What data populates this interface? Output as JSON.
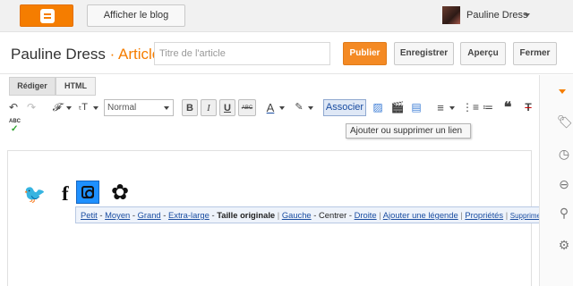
{
  "topbar": {
    "view_blog_label": "Afficher le blog",
    "user_name": "Pauline Dress"
  },
  "header": {
    "blog_name": "Pauline Dress",
    "separator": "·",
    "post_kind": "Article",
    "title_placeholder": "Titre de l'article",
    "publish_label": "Publier",
    "save_label": "Enregistrer",
    "preview_label": "Aperçu",
    "close_label": "Fermer"
  },
  "editor": {
    "tabs": [
      {
        "label": "Rédiger",
        "active": true
      },
      {
        "label": "HTML",
        "active": false
      }
    ],
    "toolbar": {
      "font_family_glyph": "𝓕",
      "font_size_glyph": "ₜT",
      "format_value": "Normal",
      "bold": "B",
      "italic": "I",
      "underline": "U",
      "strike": "ABC",
      "text_color": "A",
      "link_label": "Associer",
      "quote": "❝",
      "clear_format": "T",
      "spellcheck": "ABC"
    },
    "tooltip": "Ajouter ou supprimer un lien"
  },
  "content": {
    "image_bubble": {
      "sizes": [
        "Petit",
        "Moyen",
        "Grand",
        "Extra-large"
      ],
      "current_size": "Taille originale",
      "align_left": "Gauche",
      "align_center": "Centrer",
      "align_right": "Droite",
      "add_caption": "Ajouter une légende",
      "properties": "Propriétés",
      "remove": "Supprimer",
      "close": "×"
    }
  },
  "colors": {
    "brand_orange": "#f57d00",
    "link_blue": "#1a4da1",
    "selection_blue": "#1e90ff"
  }
}
